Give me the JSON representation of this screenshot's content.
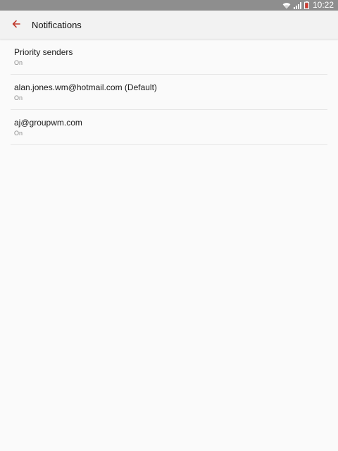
{
  "status_bar": {
    "time": "10:22",
    "icons": [
      "wifi-icon",
      "signal-icon",
      "battery-icon"
    ],
    "background_color": "#8e8e8e"
  },
  "app_bar": {
    "back_icon": "arrow-left-icon",
    "title": "Notifications",
    "accent_color": "#c0392b"
  },
  "list": {
    "items": [
      {
        "title": "Priority senders",
        "subtitle": "On"
      },
      {
        "title": "alan.jones.wm@hotmail.com (Default)",
        "subtitle": "On"
      },
      {
        "title": "aj@groupwm.com",
        "subtitle": "On"
      }
    ]
  }
}
